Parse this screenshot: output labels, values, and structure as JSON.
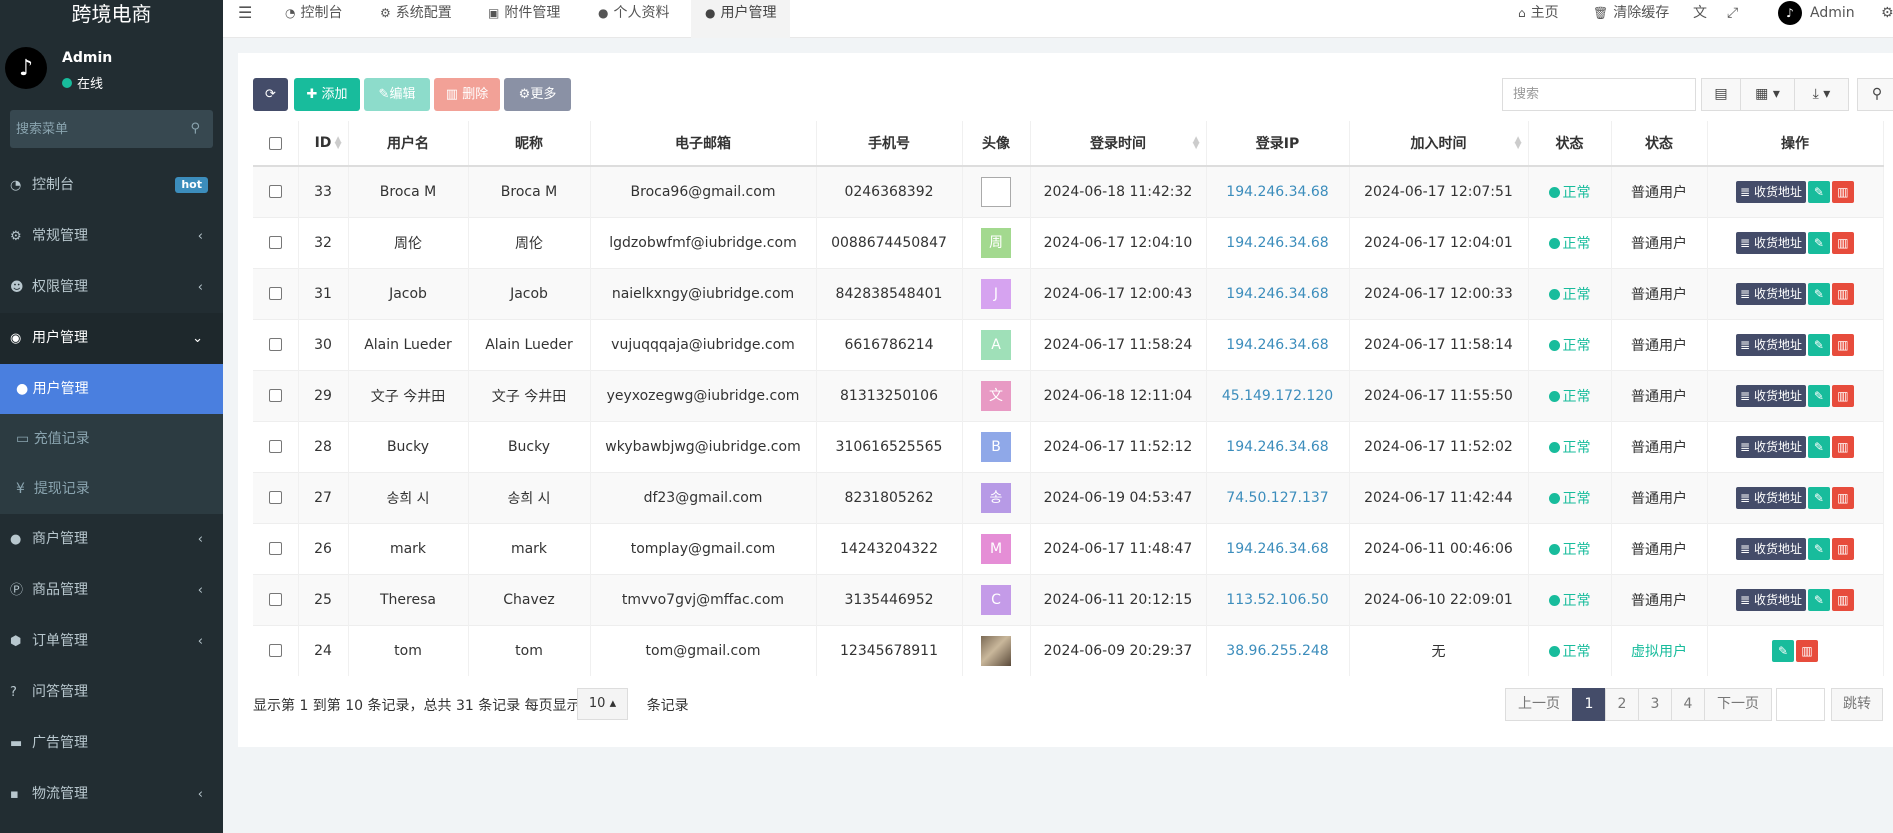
{
  "sidebar": {
    "logo": "跨境电商",
    "user_name": "Admin",
    "user_status": "在线",
    "avatar_icon": "tiktok-logo",
    "search_placeholder": "搜索菜单",
    "menu": [
      {
        "label": "控制台",
        "icon": "dashboard-icon",
        "badge": "hot"
      },
      {
        "label": "常规管理",
        "icon": "cogs-icon",
        "arrow": "‹"
      },
      {
        "label": "权限管理",
        "icon": "group-icon",
        "arrow": "‹"
      },
      {
        "label": "用户管理",
        "icon": "user-circle-icon",
        "arrow": "⌄"
      }
    ],
    "submenu": [
      {
        "label": "用户管理",
        "icon": "user-icon"
      },
      {
        "label": "充值记录",
        "icon": "money-icon"
      },
      {
        "label": "提现记录",
        "icon": "yen-icon"
      }
    ],
    "menu2": [
      {
        "label": "商户管理",
        "icon": "apple-icon",
        "arrow": "‹"
      },
      {
        "label": "商品管理",
        "icon": "product-icon",
        "arrow": "‹"
      },
      {
        "label": "订单管理",
        "icon": "cube-icon",
        "arrow": "‹"
      },
      {
        "label": "问答管理",
        "icon": "question-icon"
      },
      {
        "label": "广告管理",
        "icon": "ad-icon"
      },
      {
        "label": "物流管理",
        "icon": "truck-icon",
        "arrow": "‹"
      }
    ]
  },
  "topbar": {
    "tabs": [
      "控制台",
      "系统配置",
      "附件管理",
      "个人资料",
      "用户管理"
    ],
    "home": "主页",
    "clear_cache": "清除缓存",
    "admin": "Admin"
  },
  "toolbar": {
    "add": "添加",
    "edit": "编辑",
    "delete": "删除",
    "more": "更多",
    "search_placeholder": "搜索"
  },
  "table": {
    "headers": [
      "ID",
      "用户名",
      "昵称",
      "电子邮箱",
      "手机号",
      "头像",
      "登录时间",
      "登录IP",
      "加入时间",
      "状态",
      "状态",
      "操作"
    ],
    "rows": [
      {
        "id": "33",
        "username": "Broca M",
        "nickname": "Broca M",
        "email": "Broca96@gmail.com",
        "phone": "0246368392",
        "avatar": {
          "type": "broken"
        },
        "login_time": "2024-06-18 11:42:32",
        "ip": "194.246.34.68",
        "join_time": "2024-06-17 12:07:51",
        "status": "正常",
        "user_type": "普通用户"
      },
      {
        "id": "32",
        "username": "周伦",
        "nickname": "周伦",
        "email": "lgdzobwfmf@iubridge.com",
        "phone": "0088674450847",
        "avatar": {
          "type": "letter",
          "letter": "周",
          "color": "#a3d98f"
        },
        "login_time": "2024-06-17 12:04:10",
        "ip": "194.246.34.68",
        "join_time": "2024-06-17 12:04:01",
        "status": "正常",
        "user_type": "普通用户"
      },
      {
        "id": "31",
        "username": "Jacob",
        "nickname": "Jacob",
        "email": "naielkxngy@iubridge.com",
        "phone": "842838548401",
        "avatar": {
          "type": "letter",
          "letter": "J",
          "color": "#d6a3f0"
        },
        "login_time": "2024-06-17 12:00:43",
        "ip": "194.246.34.68",
        "join_time": "2024-06-17 12:00:33",
        "status": "正常",
        "user_type": "普通用户"
      },
      {
        "id": "30",
        "username": "Alain Lueder",
        "nickname": "Alain Lueder",
        "email": "vujuqqqaja@iubridge.com",
        "phone": "6616786214",
        "avatar": {
          "type": "letter",
          "letter": "A",
          "color": "#9fe0b8"
        },
        "login_time": "2024-06-17 11:58:24",
        "ip": "194.246.34.68",
        "join_time": "2024-06-17 11:58:14",
        "status": "正常",
        "user_type": "普通用户"
      },
      {
        "id": "29",
        "username": "文子 今井田",
        "nickname": "文子 今井田",
        "email": "yeyxozegwg@iubridge.com",
        "phone": "81313250106",
        "avatar": {
          "type": "letter",
          "letter": "文",
          "color": "#e89ac4"
        },
        "login_time": "2024-06-18 12:11:04",
        "ip": "45.149.172.120",
        "join_time": "2024-06-17 11:55:50",
        "status": "正常",
        "user_type": "普通用户"
      },
      {
        "id": "28",
        "username": "Bucky",
        "nickname": "Bucky",
        "email": "wkybawbjwg@iubridge.com",
        "phone": "310616525565",
        "avatar": {
          "type": "letter",
          "letter": "B",
          "color": "#8fa8e8"
        },
        "login_time": "2024-06-17 11:52:12",
        "ip": "194.246.34.68",
        "join_time": "2024-06-17 11:52:02",
        "status": "正常",
        "user_type": "普通用户"
      },
      {
        "id": "27",
        "username": "송희 시",
        "nickname": "송희 시",
        "email": "df23@gmail.com",
        "phone": "8231805262",
        "avatar": {
          "type": "letter",
          "letter": "송",
          "color": "#b79ae6"
        },
        "login_time": "2024-06-19 04:53:47",
        "ip": "74.50.127.137",
        "join_time": "2024-06-17 11:42:44",
        "status": "正常",
        "user_type": "普通用户"
      },
      {
        "id": "26",
        "username": "mark",
        "nickname": "mark",
        "email": "tomplay@gmail.com",
        "phone": "14243204322",
        "avatar": {
          "type": "letter",
          "letter": "M",
          "color": "#e58ed6"
        },
        "login_time": "2024-06-17 11:48:47",
        "ip": "194.246.34.68",
        "join_time": "2024-06-11 00:46:06",
        "status": "正常",
        "user_type": "普通用户"
      },
      {
        "id": "25",
        "username": "Theresa",
        "nickname": "Chavez",
        "email": "tmvvo7gvj@mffac.com",
        "phone": "3135446952",
        "avatar": {
          "type": "letter",
          "letter": "C",
          "color": "#c49be8"
        },
        "login_time": "2024-06-11 20:12:15",
        "ip": "113.52.106.50",
        "join_time": "2024-06-10 22:09:01",
        "status": "正常",
        "user_type": "普通用户"
      },
      {
        "id": "24",
        "username": "tom",
        "nickname": "tom",
        "email": "tom@gmail.com",
        "phone": "12345678911",
        "avatar": {
          "type": "photo"
        },
        "login_time": "2024-06-09 20:29:37",
        "ip": "38.96.255.248",
        "join_time": "无",
        "status": "正常",
        "user_type": "虚拟用户"
      }
    ],
    "address_btn": "收货地址"
  },
  "pagination": {
    "info": "显示第 1 到第 10 条记录，总共 31 条记录 每页显示",
    "per_page": "10",
    "suffix": "条记录",
    "prev": "上一页",
    "pages": [
      "1",
      "2",
      "3",
      "4"
    ],
    "next": "下一页",
    "jump": "跳转"
  }
}
